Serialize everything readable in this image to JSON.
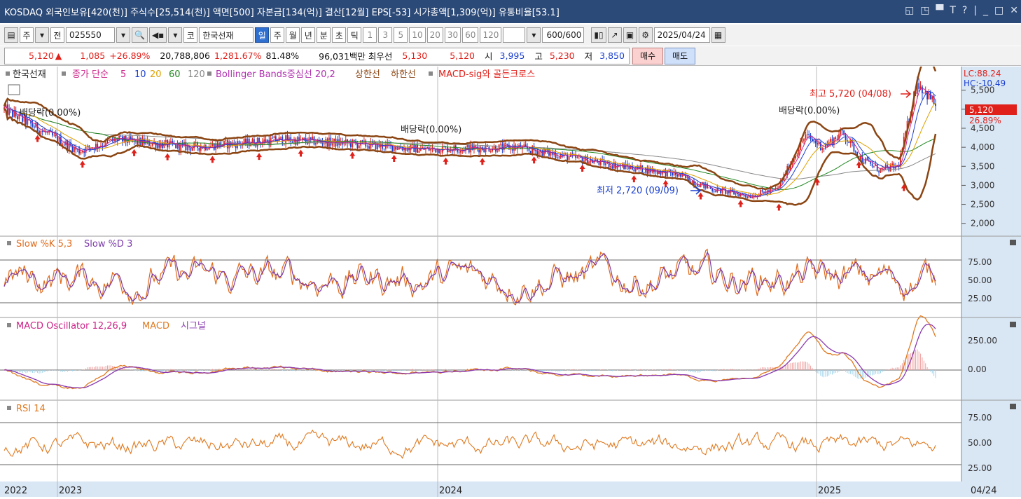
{
  "window": {
    "title": "KOSDAQ 외국인보유[420(천)] 주식수[25,514(천)] 액면[500] 자본금[134(억)] 결산[12월] EPS[-53] 시가총액[1,309(억)] 유통비율[53.1]",
    "buttons": [
      "◱",
      "◳",
      "▀",
      "T",
      "?",
      "|",
      "_",
      "□",
      "✕"
    ]
  },
  "toolbar": {
    "view_icon": "▤",
    "period_main": "주",
    "dropdown": "▾",
    "prev_label": "전",
    "stock_code": "025550",
    "search_icon": "🔍",
    "sound_icon": "◀▪",
    "market_label": "코",
    "stock_name": "한국선재",
    "timeframes": [
      "일",
      "주",
      "월",
      "년",
      "분",
      "초",
      "틱"
    ],
    "active_timeframe": "일",
    "intervals": [
      "1",
      "3",
      "5",
      "10",
      "20",
      "30",
      "60",
      "120"
    ],
    "count": "600",
    "count_total": "/600",
    "date": "2025/04/24",
    "calendar_icon": "▦"
  },
  "quote": {
    "price": "5,120",
    "up_arrow": "▲",
    "change": "1,085",
    "change_pct": "+26.89%",
    "volume": "20,788,806",
    "volume_pct": "1,281.67%",
    "turnover": "81.48%",
    "amount": "96,031백만",
    "best_ask_label": "최우선",
    "best_ask": "5,130",
    "best_bid": "5,120",
    "open_label": "시",
    "open": "3,995",
    "high_label": "고",
    "high": "5,230",
    "low_label": "저",
    "low": "3,850",
    "buy_label": "매수",
    "sell_label": "매도"
  },
  "legend": {
    "stock": "한국선재",
    "ma_label": "종가 단순",
    "ma_periods": [
      "5",
      "10",
      "20",
      "60",
      "120"
    ],
    "bb_center": "Bollinger Bands중심선 20,2",
    "bb_upper": "상한선",
    "bb_lower": "하한선",
    "macd_cross": "MACD-sig와 골든크로스",
    "lc": "LC:88.24",
    "hc": "HC:-10.49"
  },
  "price_panel": {
    "axis_ticks": [
      "5,500",
      "5,000",
      "4,500",
      "4,000",
      "3,500",
      "3,000",
      "2,500",
      "2,000"
    ],
    "current_price_tag": "5,120",
    "current_pct_tag": "26.89%",
    "annotations": {
      "dividend": "배당락(0.00%)",
      "high": "최고 5,720 (04/08)",
      "low": "최저 2,720 (09/09)"
    }
  },
  "stoch_panel": {
    "title_k": "Slow %K 5,3",
    "title_d": "Slow %D 3",
    "axis_ticks": [
      "75.00",
      "50.00",
      "25.00"
    ]
  },
  "macd_panel": {
    "title_osc": "MACD Oscillator 12,26,9",
    "title_macd": "MACD",
    "title_signal": "시그널",
    "axis_ticks": [
      "250.00",
      "0.00"
    ]
  },
  "rsi_panel": {
    "title": "RSI 14",
    "axis_ticks": [
      "75.00",
      "50.00",
      "25.00"
    ]
  },
  "x_axis": {
    "labels": [
      "2022",
      "2023",
      "2024",
      "2025"
    ],
    "right_label": "04/24"
  },
  "colors": {
    "up": "#e0201a",
    "down": "#1a3fd0",
    "bb": "#8b4513",
    "stoch_k": "#e06a1a",
    "stoch_d": "#7a3aa8",
    "macd": "#e07a20",
    "signal": "#8a3ab0",
    "rsi": "#e07a20",
    "fill_blue": "#9fd3ea"
  },
  "chart_data": [
    {
      "type": "line",
      "panel": "price",
      "title": "",
      "x": [
        "2022",
        "2023",
        "2024",
        "2025",
        "04/24"
      ],
      "ylim": [
        1700,
        5900
      ],
      "series": [
        {
          "values_x": [
            0,
            0.05,
            0.08,
            0.12,
            0.2,
            0.3,
            0.37,
            0.45,
            0.55,
            0.65,
            0.72,
            0.76,
            0.8,
            0.83,
            0.86,
            0.88,
            0.9,
            0.92,
            0.94,
            0.96,
            0.98,
            1.0
          ],
          "values": [
            5000,
            4300,
            3900,
            4200,
            4000,
            4200,
            4100,
            3950,
            4000,
            3550,
            3300,
            2900,
            2720,
            2900,
            4300,
            4000,
            4400,
            3700,
            3400,
            3500,
            5720,
            5120
          ]
        }
      ]
    }
  ]
}
